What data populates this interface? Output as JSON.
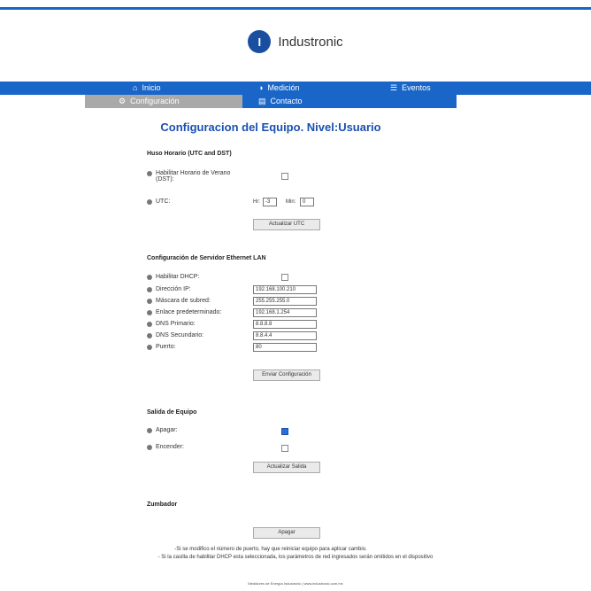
{
  "brand": {
    "name": "Industronic",
    "letter": "I"
  },
  "nav": {
    "inicio": "Inicio",
    "medicion": "Medición",
    "eventos": "Eventos",
    "configuracion": "Configuración",
    "contacto": "Contacto"
  },
  "page_title": "Configuracion del Equipo. Nivel:Usuario",
  "huso": {
    "heading": "Huso Horario (UTC and DST)",
    "dst_label": "Habilitar Horario de Verano (DST):",
    "utc_label": "UTC:",
    "hr_label": "Hr:",
    "hr_value": "-3",
    "min_label": "Min:",
    "min_value": "0",
    "button": "Actualizar UTC"
  },
  "ethernet": {
    "heading": "Configuración de Servidor Ethernet LAN",
    "dhcp_label": "Habilitar DHCP:",
    "ip_label": "Dirección IP:",
    "ip_value": "192.168.100.210",
    "mask_label": "Máscara de subred:",
    "mask_value": "255.255.255.0",
    "gateway_label": "Enlace predeterminado:",
    "gateway_value": "192.168.1.254",
    "dns1_label": "DNS Primario:",
    "dns1_value": "8.8.8.8",
    "dns2_label": "DNS Secundario:",
    "dns2_value": "8.8.4.4",
    "port_label": "Puerto:",
    "port_value": "80",
    "button": "Enviar Configuración"
  },
  "salida": {
    "heading": "Salida de Equipo",
    "apagar_label": "Apagar:",
    "encender_label": "Encender:",
    "button": "Actualizar Salida"
  },
  "zumbador": {
    "heading": "Zumbador",
    "button": "Apagar"
  },
  "notes": {
    "line1": "-Si se modifico el número de puerto, hay que reiniciar equipo para aplicar cambio.",
    "line2": "- Si la casilla de habilitar DHCP esta seleccionada, los parámetros de red ingresados serán omitidos en el dispositivo"
  },
  "footer": "Medidores de Energía Industronic | www.industronic.com.mx",
  "colors": {
    "accent": "#1a66c8",
    "title": "#1a50b0",
    "tab_active": "#a9a9a9"
  }
}
